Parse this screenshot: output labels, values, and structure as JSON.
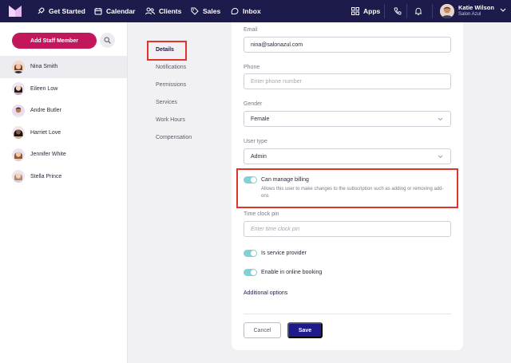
{
  "nav": {
    "items": [
      {
        "label": "Get Started",
        "icon": "rocket-icon"
      },
      {
        "label": "Calendar",
        "icon": "calendar-icon"
      },
      {
        "label": "Clients",
        "icon": "clients-icon"
      },
      {
        "label": "Sales",
        "icon": "tag-icon"
      },
      {
        "label": "Inbox",
        "icon": "inbox-icon"
      }
    ],
    "apps_label": "Apps",
    "user": {
      "name": "Katie Wilson",
      "salon": "Salon Azul"
    }
  },
  "staff": {
    "add_button": "Add Staff Member",
    "members": [
      {
        "name": "Nina Smith",
        "active": true
      },
      {
        "name": "Eileen Low",
        "active": false
      },
      {
        "name": "Andre Butler",
        "active": false
      },
      {
        "name": "Harriet Love",
        "active": false
      },
      {
        "name": "Jennifer White",
        "active": false
      },
      {
        "name": "Stella Prince",
        "active": false
      }
    ]
  },
  "menu": {
    "items": [
      "Details",
      "Notifications",
      "Permissions",
      "Services",
      "Work Hours",
      "Compensation"
    ],
    "active": "Details"
  },
  "form": {
    "email": {
      "label": "Email",
      "value": "nina@salonazul.com"
    },
    "phone": {
      "label": "Phone",
      "placeholder": "Enter phone number"
    },
    "gender": {
      "label": "Gender",
      "value": "Female"
    },
    "user_type": {
      "label": "User type",
      "value": "Admin"
    },
    "billing": {
      "label": "Can manage billing",
      "description": "Allows this user to make changes to the subscription such as adding or removing add-ons",
      "enabled": true
    },
    "time_clock": {
      "label": "Time clock pin",
      "placeholder": "Enter time clock pin"
    },
    "service_provider": {
      "label": "Is service provider",
      "enabled": true
    },
    "online_booking": {
      "label": "Enable in online booking",
      "enabled": true
    },
    "additional_options": "Additional options",
    "cancel_label": "Cancel",
    "save_label": "Save"
  },
  "colors": {
    "nav_bg": "#1d1b4b",
    "accent_pink": "#c2185b",
    "toggle_on": "#7fd3d6",
    "save_button": "#1d1b8b",
    "highlight": "#e0352b"
  }
}
